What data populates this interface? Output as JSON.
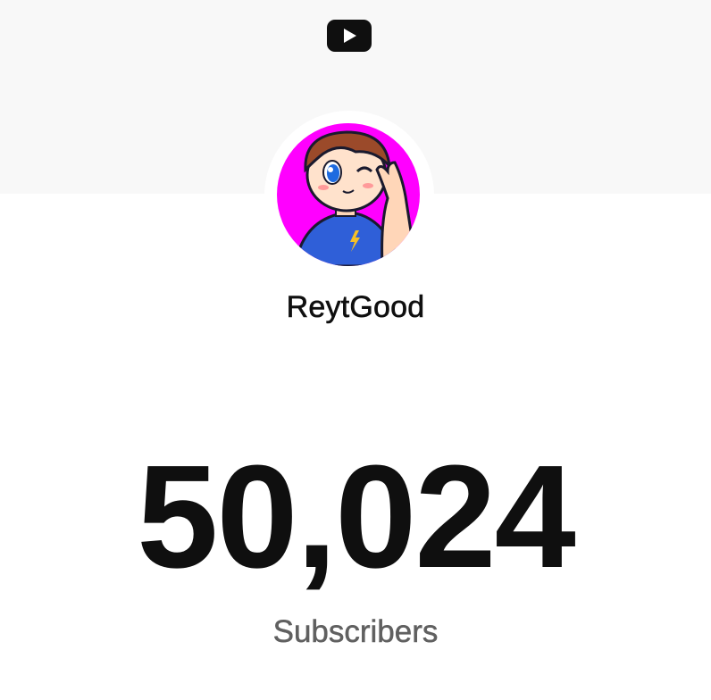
{
  "header": {
    "logo_icon": "youtube-play-icon",
    "logo_color": "#0f0f0f"
  },
  "channel": {
    "name": "ReytGood",
    "avatar_icon": "channel-avatar-cartoon-boy",
    "avatar_background": "#ff00ff"
  },
  "stats": {
    "subscriber_count": "50,024",
    "subscriber_label": "Subscribers"
  },
  "colors": {
    "banner": "#f8f8f8",
    "primary_text": "#0f0f0f",
    "secondary_text": "#606060"
  }
}
